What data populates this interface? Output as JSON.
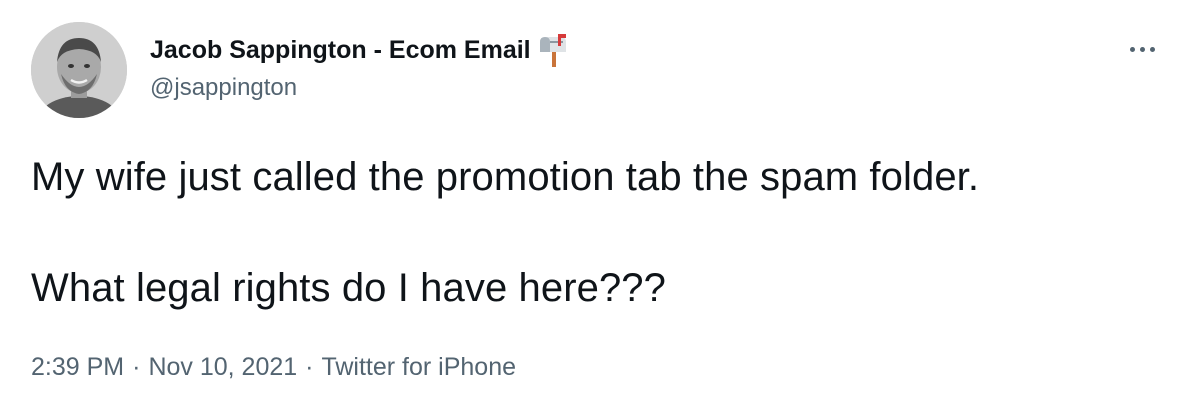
{
  "author": {
    "display_name": "Jacob Sappington - Ecom Email",
    "badge_icon": "mailbox-icon",
    "handle": "@jsappington"
  },
  "tweet": {
    "lines": [
      "My wife just called the promotion tab the spam folder.",
      "What legal rights do I have here???"
    ]
  },
  "meta": {
    "time": "2:39 PM",
    "separator": "·",
    "date": "Nov 10, 2021",
    "source": "Twitter for iPhone"
  },
  "icons": {
    "more": "more-options-icon"
  },
  "colors": {
    "text_primary": "#0f1419",
    "text_secondary": "#536471",
    "background": "#ffffff"
  }
}
